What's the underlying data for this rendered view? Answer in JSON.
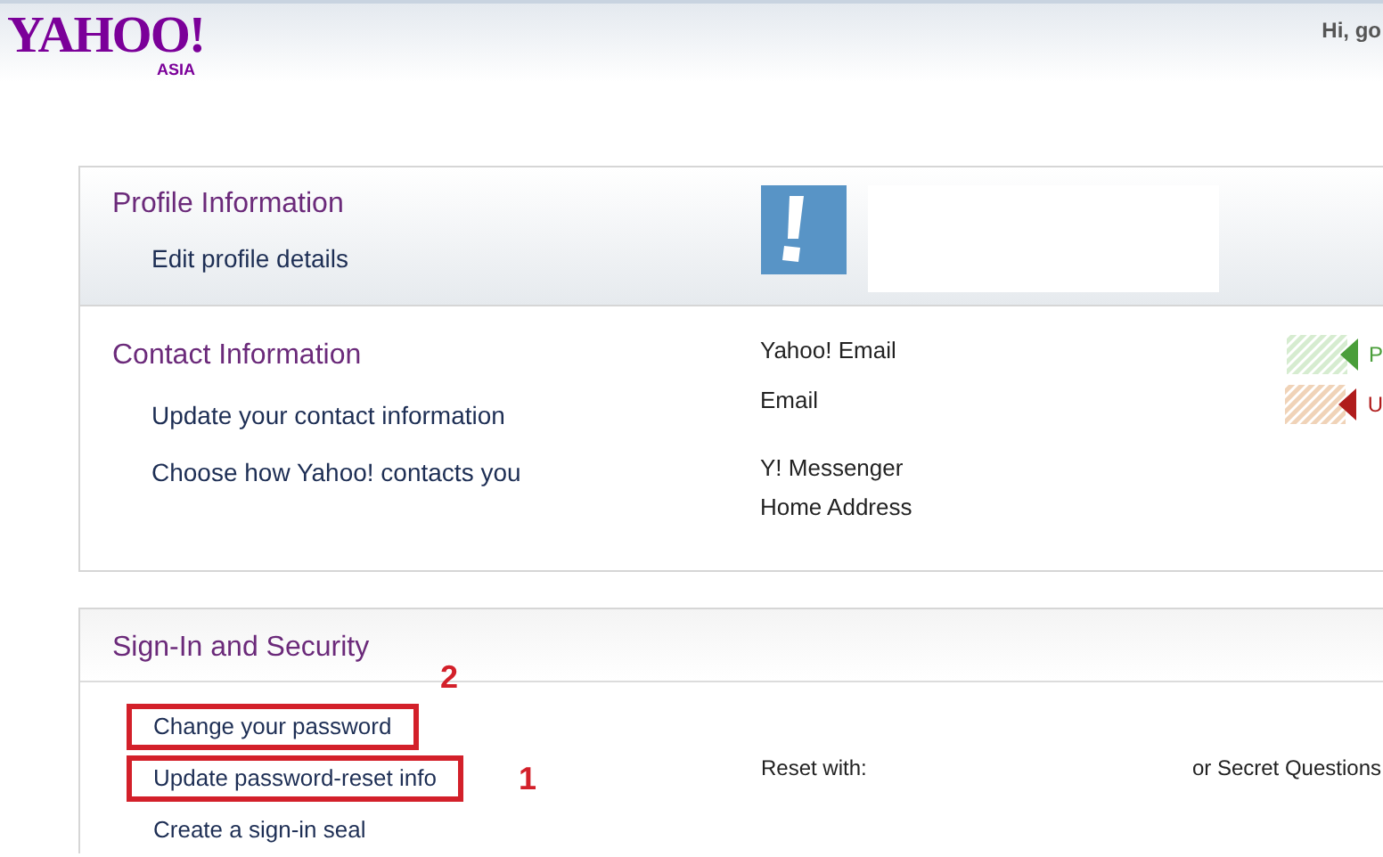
{
  "header": {
    "logo": "YAHOO!",
    "logo_region": "ASIA",
    "greeting": "Hi, go"
  },
  "profile": {
    "title": "Profile Information",
    "links": [
      {
        "label": "Edit profile details"
      }
    ]
  },
  "contact": {
    "title": "Contact Information",
    "links": [
      {
        "label": "Update your contact information"
      },
      {
        "label": "Choose how Yahoo! contacts you"
      }
    ],
    "fields": [
      {
        "label": "Yahoo! Email",
        "status": "P",
        "color": "#4a9e3a"
      },
      {
        "label": "Email",
        "status": "U",
        "color": "#b01c1c"
      },
      {
        "label": "Y! Messenger"
      },
      {
        "label": "Home Address"
      }
    ]
  },
  "security": {
    "title": "Sign-In and Security",
    "links": [
      {
        "label": "Change your password",
        "highlighted": true,
        "annotation": "2"
      },
      {
        "label": "Update password-reset info",
        "highlighted": true,
        "annotation": "1"
      },
      {
        "label": "Create a sign-in seal",
        "highlighted": false
      }
    ],
    "reset_label": "Reset with:",
    "reset_options": "or Secret Questions"
  }
}
